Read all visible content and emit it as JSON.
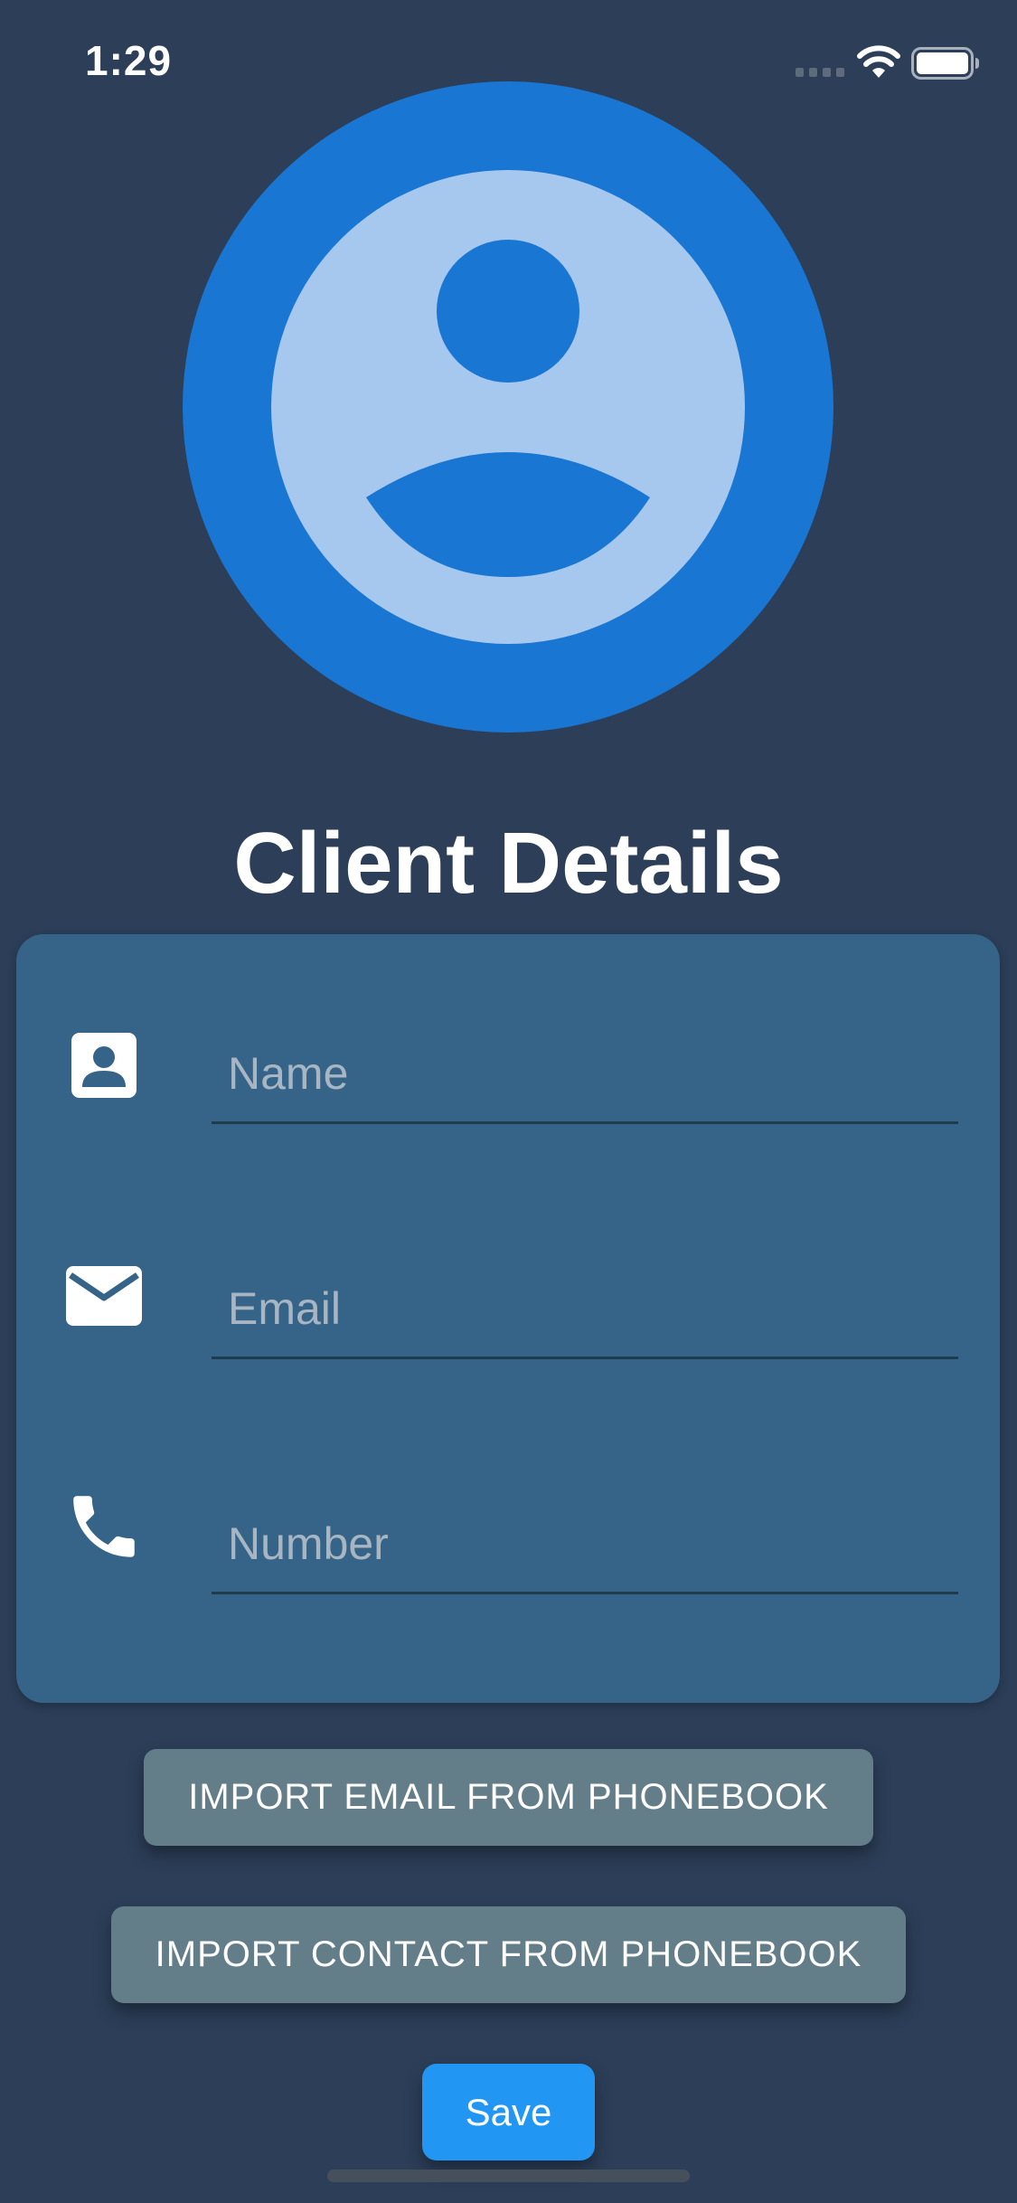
{
  "status_bar": {
    "time": "1:29",
    "signal_icon": "signal-dots-icon",
    "wifi_icon": "wifi-icon",
    "battery_icon": "battery-full-icon"
  },
  "avatar": {
    "icon": "account-circle-icon",
    "outer_color": "#1976d2",
    "inner_color": "#a6c8ee"
  },
  "page": {
    "title": "Client Details"
  },
  "form": {
    "fields": [
      {
        "icon": "contact-card-icon",
        "placeholder": "Name",
        "value": ""
      },
      {
        "icon": "mail-icon",
        "placeholder": "Email",
        "value": ""
      },
      {
        "icon": "phone-icon",
        "placeholder": "Number",
        "value": ""
      }
    ]
  },
  "actions": {
    "import_email_label": "IMPORT EMAIL FROM PHONEBOOK",
    "import_contact_label": "IMPORT CONTACT FROM PHONEBOOK",
    "save_label": "Save"
  },
  "colors": {
    "background": "#2c3e58",
    "card": "#356488",
    "secondary_button": "#637d89",
    "primary_button": "#2196f3"
  }
}
